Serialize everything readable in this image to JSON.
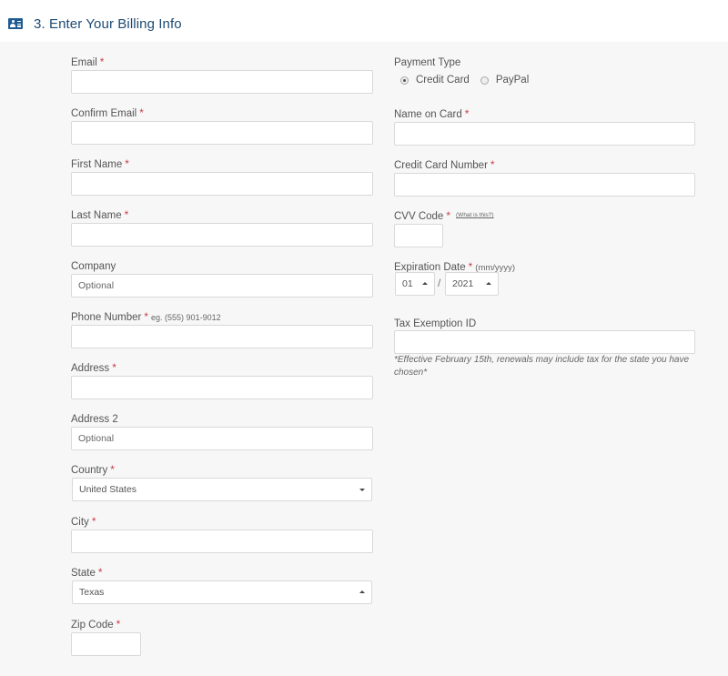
{
  "header": {
    "icon": "id-card-icon",
    "title": "3. Enter Your Billing Info",
    "accent": "#1f5b93"
  },
  "colors": {
    "required": "#c8414a",
    "panel_bg": "#f7f7f7",
    "title": "#1d4a74"
  },
  "left": {
    "email": {
      "label": "Email",
      "required": "*",
      "value": ""
    },
    "confirm_email": {
      "label": "Confirm Email",
      "required": "*",
      "value": ""
    },
    "first_name": {
      "label": "First Name",
      "required": "*",
      "value": ""
    },
    "last_name": {
      "label": "Last Name",
      "required": "*",
      "value": ""
    },
    "company": {
      "label": "Company",
      "placeholder": "Optional"
    },
    "phone": {
      "label": "Phone Number",
      "required": "*",
      "hint": "eg. (555) 901-9012",
      "value": ""
    },
    "address": {
      "label": "Address",
      "required": "*",
      "value": ""
    },
    "address2": {
      "label": "Address 2",
      "placeholder": "Optional"
    },
    "country": {
      "label": "Country",
      "required": "*",
      "selected": "United States"
    },
    "city": {
      "label": "City",
      "required": "*",
      "value": ""
    },
    "state": {
      "label": "State",
      "required": "*",
      "selected": "Texas"
    },
    "zip": {
      "label": "Zip Code",
      "required": "*",
      "value": ""
    }
  },
  "right": {
    "payment_type": {
      "label": "Payment Type",
      "options": [
        "Credit Card",
        "PayPal"
      ],
      "selected": "Credit Card"
    },
    "name_on_card": {
      "label": "Name on Card",
      "required": "*",
      "value": ""
    },
    "card_number": {
      "label": "Credit Card Number",
      "required": "*",
      "value": ""
    },
    "cvv": {
      "label": "CVV Code",
      "required": "*",
      "help_link": "(What is this?)",
      "value": ""
    },
    "expiration": {
      "label": "Expiration Date",
      "required": "*",
      "format_hint": "(mm/yyyy)",
      "month": "01",
      "separator": "/",
      "year": "2021"
    },
    "tax_id": {
      "label": "Tax Exemption ID",
      "value": "",
      "note": "*Effective February 15th, renewals may include tax for the state you have chosen*"
    }
  }
}
